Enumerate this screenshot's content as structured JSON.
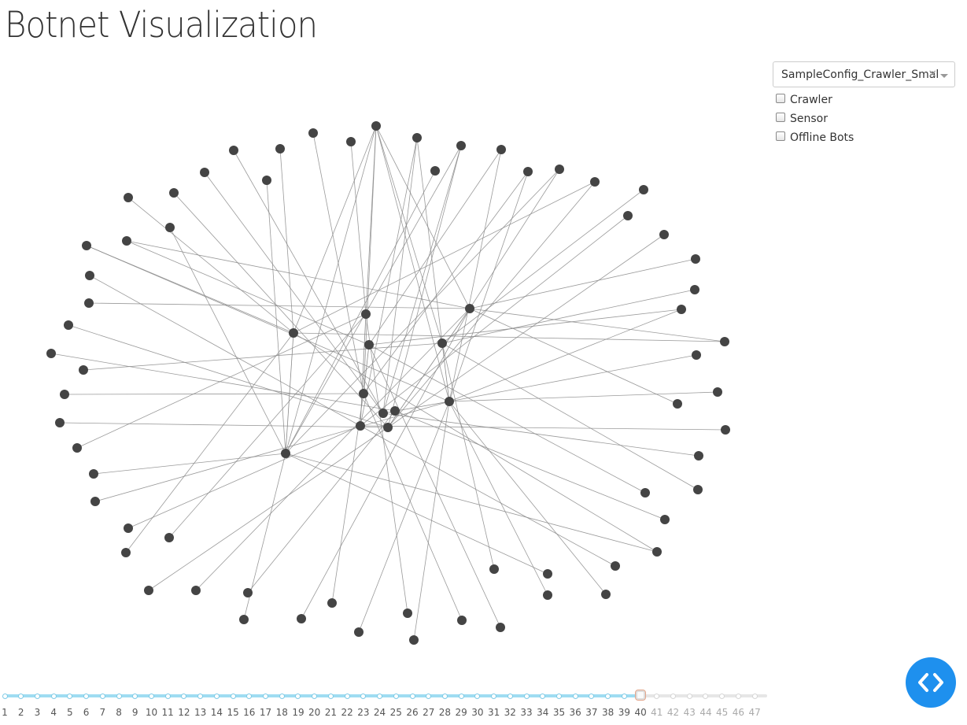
{
  "header": {
    "title": "Botnet Visualization"
  },
  "config_select": {
    "value": "SampleConfig_Crawler_Small",
    "clear_glyph": "×"
  },
  "filters": [
    {
      "label": "Crawler",
      "checked": false
    },
    {
      "label": "Sensor",
      "checked": false
    },
    {
      "label": "Offline Bots",
      "checked": false
    }
  ],
  "timeline": {
    "labels": [
      "1",
      "2",
      "3",
      "4",
      "5",
      "6",
      "7",
      "8",
      "9",
      "10",
      "11",
      "12",
      "13",
      "14",
      "15",
      "16",
      "17",
      "18",
      "19",
      "20",
      "21",
      "22",
      "23",
      "24",
      "25",
      "26",
      "27",
      "28",
      "29",
      "30",
      "31",
      "32",
      "33",
      "34",
      "35",
      "36",
      "37",
      "38",
      "39",
      "40",
      "41",
      "42",
      "43",
      "44",
      "45",
      "46",
      "47"
    ],
    "current": "40"
  },
  "colors": {
    "node": "#444444",
    "edge": "#888888",
    "timeline_active": "#9fdcf2",
    "timeline_inactive": "#e6e6e6",
    "nav_button": "#1e90ee"
  },
  "icons": {
    "nav": "code-brackets-icon"
  }
}
